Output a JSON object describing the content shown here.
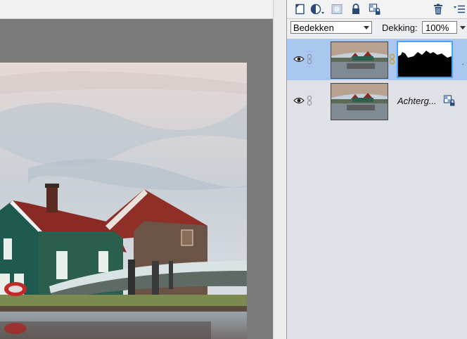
{
  "panel": {
    "toolbar_icons": [
      "new-layer-icon",
      "adjustment-layer-icon",
      "add-mask-icon",
      "lock-icon",
      "lock-all-icon",
      "trash-icon",
      "panel-menu-icon"
    ],
    "blend_mode": "Bedekken",
    "opacity_label": "Dekking:",
    "opacity_value": "100%"
  },
  "layers": [
    {
      "name": "",
      "visible": true,
      "has_mask": true,
      "selected": true
    },
    {
      "name": "Achterg...",
      "visible": true,
      "has_mask": false,
      "selected": false,
      "locked": true
    }
  ],
  "colors": {
    "selected_row": "#a9c7ee",
    "mask_border": "#4aa3f5",
    "panel_bg": "#dfe1e6",
    "canvas_bg": "#7a7a7a"
  }
}
